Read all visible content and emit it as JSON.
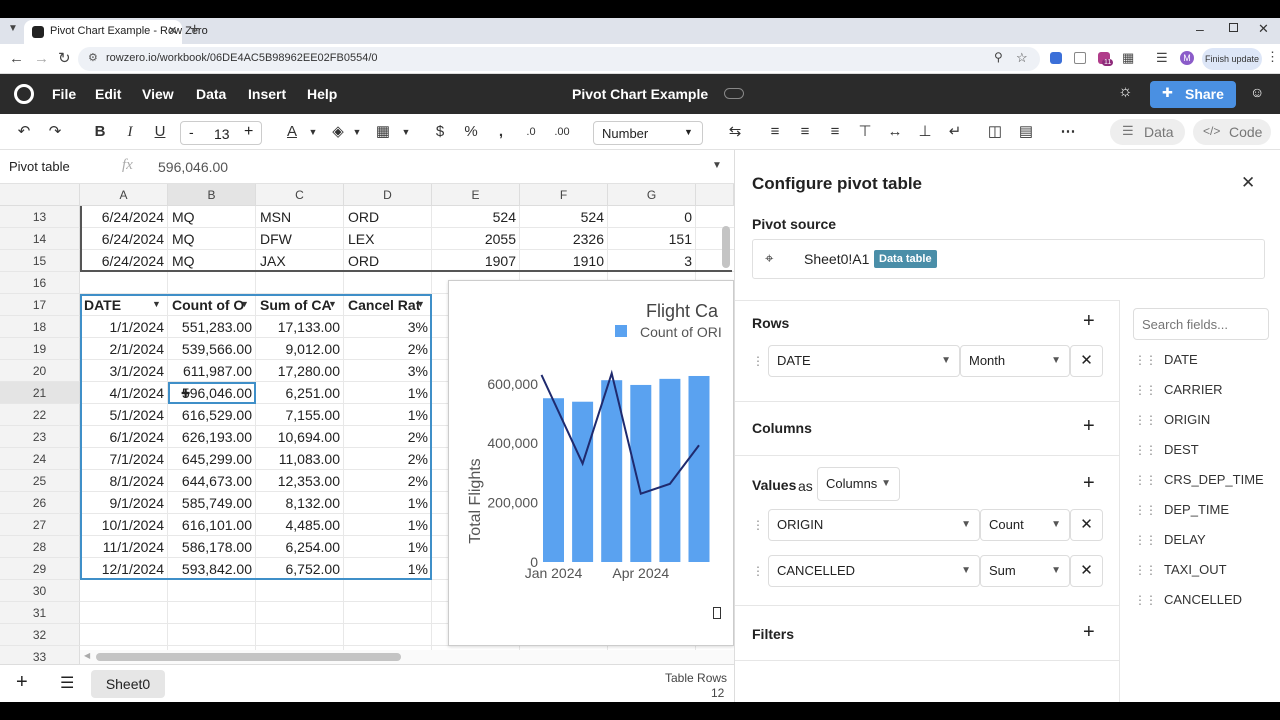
{
  "browser": {
    "tab_title": "Pivot Chart Example - Row Zero",
    "url": "rowzero.io/workbook/06DE4AC5B98962EE02FB0554/0",
    "finish_update": "Finish update",
    "avatar_letter": "M",
    "ext_badge": "11"
  },
  "app": {
    "menu": [
      "File",
      "Edit",
      "View",
      "Data",
      "Insert",
      "Help"
    ],
    "title": "Pivot Chart Example",
    "share_label": "Share"
  },
  "toolbar": {
    "font_size": "13",
    "number_format": "Number",
    "data_label": "Data",
    "code_label": "Code"
  },
  "formula": {
    "name_box": "Pivot table",
    "fx": "fx",
    "value": "596,046.00"
  },
  "grid": {
    "columns": [
      "A",
      "B",
      "C",
      "D",
      "E",
      "F",
      "G"
    ],
    "row_numbers": [
      "13",
      "14",
      "15",
      "16",
      "17",
      "18",
      "19",
      "20",
      "21",
      "22",
      "23",
      "24",
      "25",
      "26",
      "27",
      "28",
      "29",
      "30",
      "31",
      "32",
      "33"
    ],
    "data_rows": [
      [
        "6/24/2024",
        "MQ",
        "MSN",
        "ORD",
        "524",
        "524",
        "0"
      ],
      [
        "6/24/2024",
        "MQ",
        "DFW",
        "LEX",
        "2055",
        "2326",
        "151"
      ],
      [
        "6/24/2024",
        "MQ",
        "JAX",
        "ORD",
        "1907",
        "1910",
        "3"
      ]
    ],
    "pivot_headers": [
      "DATE",
      "Count of O",
      "Sum of CA",
      "Cancel Rat"
    ],
    "pivot_rows": [
      [
        "1/1/2024",
        "551,283.00",
        "17,133.00",
        "3%"
      ],
      [
        "2/1/2024",
        "539,566.00",
        "9,012.00",
        "2%"
      ],
      [
        "3/1/2024",
        "611,987.00",
        "17,280.00",
        "3%"
      ],
      [
        "4/1/2024",
        "596,046.00",
        "6,251.00",
        "1%"
      ],
      [
        "5/1/2024",
        "616,529.00",
        "7,155.00",
        "1%"
      ],
      [
        "6/1/2024",
        "626,193.00",
        "10,694.00",
        "2%"
      ],
      [
        "7/1/2024",
        "645,299.00",
        "11,083.00",
        "2%"
      ],
      [
        "8/1/2024",
        "644,673.00",
        "12,353.00",
        "2%"
      ],
      [
        "9/1/2024",
        "585,749.00",
        "8,132.00",
        "1%"
      ],
      [
        "10/1/2024",
        "616,101.00",
        "4,485.00",
        "1%"
      ],
      [
        "11/1/2024",
        "586,178.00",
        "6,254.00",
        "1%"
      ],
      [
        "12/1/2024",
        "593,842.00",
        "6,752.00",
        "1%"
      ]
    ]
  },
  "chart_data": {
    "type": "bar",
    "title": "Flight Ca",
    "legend": [
      "Count of ORI"
    ],
    "legend_position": "top",
    "ylabel": "Total Flights",
    "x_tick_labels": [
      "Jan 2024",
      "Apr 2024"
    ],
    "y_tick_labels": [
      "0",
      "200,000",
      "400,000",
      "600,000"
    ],
    "ylim": [
      0,
      680000
    ],
    "categories": [
      "Jan 2024",
      "Feb 2024",
      "Mar 2024",
      "Apr 2024",
      "May 2024",
      "Jun 2024"
    ],
    "series": [
      {
        "name": "Count of ORI",
        "type": "bar",
        "values": [
          551283,
          539566,
          611987,
          596046,
          616529,
          626193
        ]
      },
      {
        "type": "line",
        "values": [
          17133,
          9012,
          17280,
          6251,
          7155,
          10694
        ],
        "secondary_range": [
          0,
          18500
        ]
      }
    ],
    "colors": {
      "bar": "#5aa2f0",
      "line": "#1f2a6e"
    }
  },
  "sheet": {
    "tab": "Sheet0",
    "table_rows_label": "Table Rows",
    "table_rows_value": "12"
  },
  "panel": {
    "title": "Configure pivot table",
    "source_label": "Pivot source",
    "source_value": "Sheet0!A1",
    "source_badge": "Data table",
    "rows_label": "Rows",
    "row_field": "DATE",
    "row_group": "Month",
    "columns_label": "Columns",
    "values_label": "Values",
    "values_as": "as",
    "values_mode": "Columns",
    "value_fields": [
      {
        "field": "ORIGIN",
        "agg": "Count"
      },
      {
        "field": "CANCELLED",
        "agg": "Sum"
      }
    ],
    "filters_label": "Filters",
    "search_placeholder": "Search fields...",
    "fields": [
      "DATE",
      "CARRIER",
      "ORIGIN",
      "DEST",
      "CRS_DEP_TIME",
      "DEP_TIME",
      "DELAY",
      "TAXI_OUT",
      "CANCELLED"
    ]
  }
}
